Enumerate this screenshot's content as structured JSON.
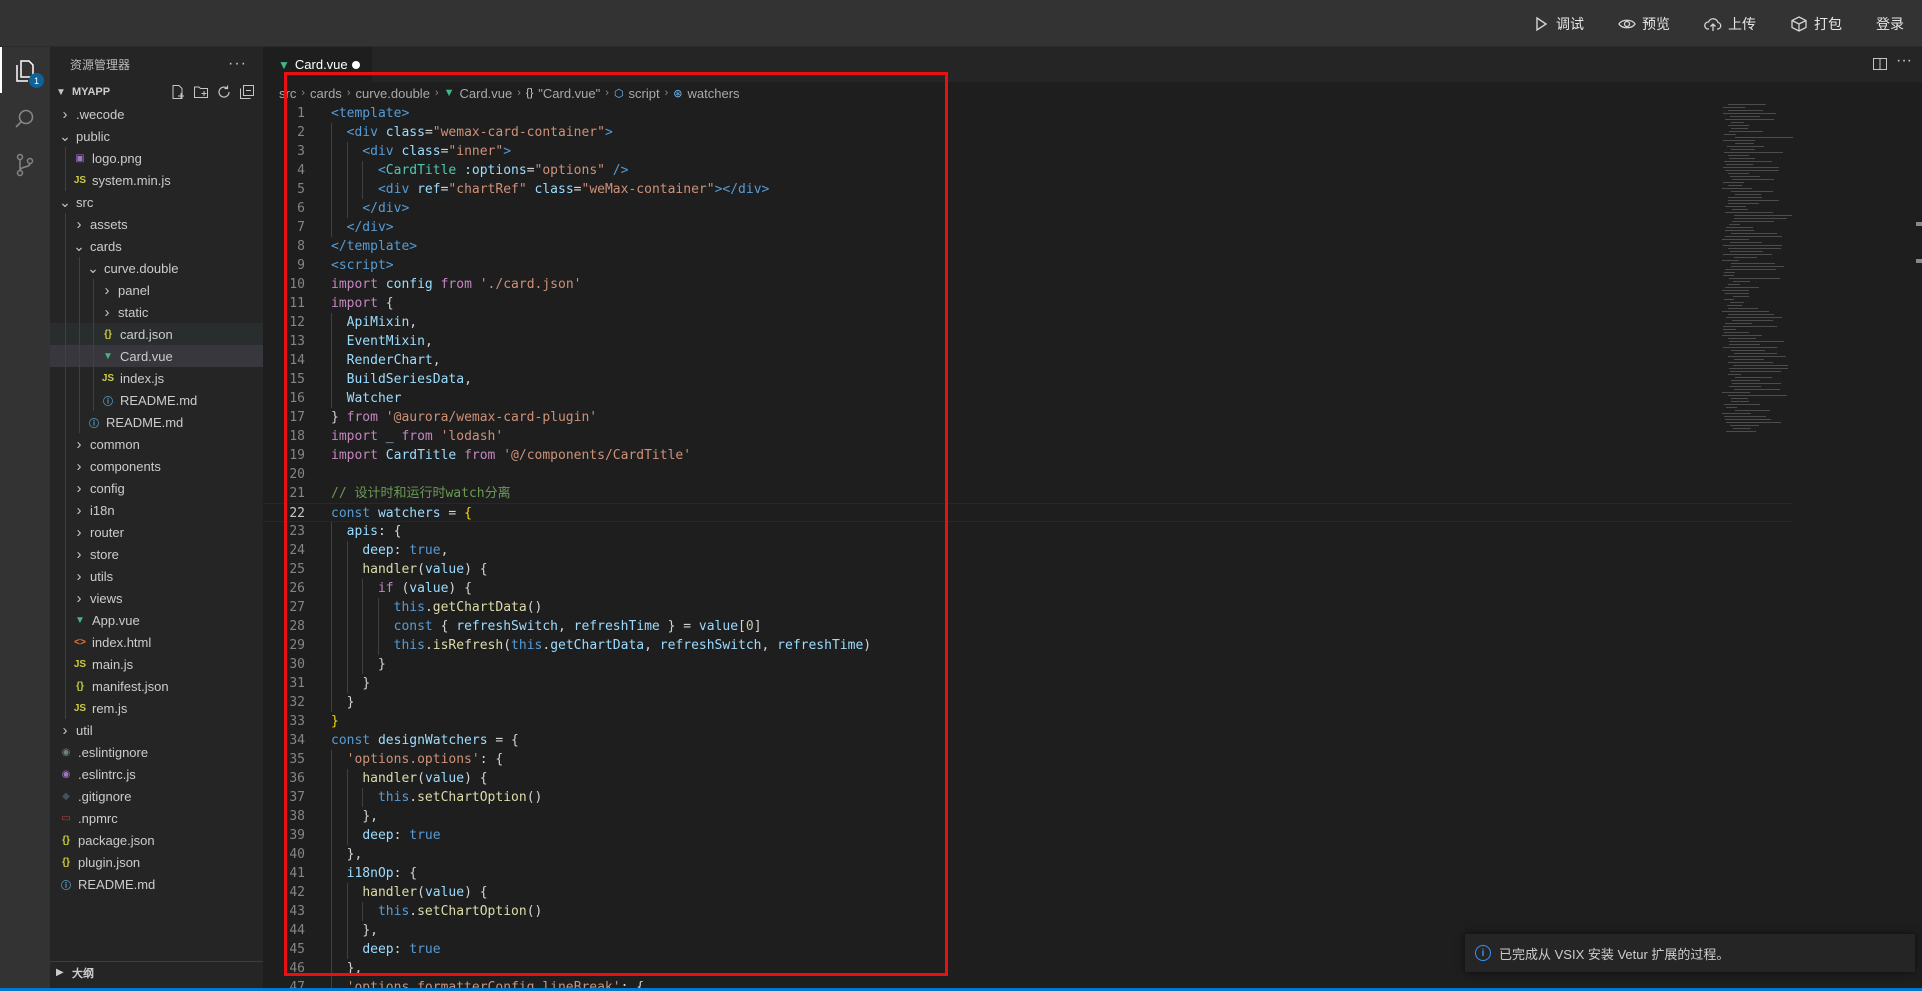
{
  "topbar": {
    "actions": [
      {
        "name": "debug",
        "label": "调试",
        "icon": "play-icon"
      },
      {
        "name": "preview",
        "label": "预览",
        "icon": "eye-icon"
      },
      {
        "name": "upload",
        "label": "上传",
        "icon": "cloud-upload-icon"
      },
      {
        "name": "package",
        "label": "打包",
        "icon": "box-icon"
      },
      {
        "name": "login",
        "label": "登录",
        "icon": ""
      }
    ]
  },
  "activitybar": {
    "explorer_badge": "1"
  },
  "sidebar": {
    "title": "资源管理器",
    "more": "···",
    "section": "MYAPP",
    "outline_label": "大纲",
    "tree": [
      {
        "label": ".wecode",
        "depth": 0,
        "type": "folder",
        "open": false
      },
      {
        "label": "public",
        "depth": 0,
        "type": "folder",
        "open": true
      },
      {
        "label": "logo.png",
        "depth": 1,
        "type": "image"
      },
      {
        "label": "system.min.js",
        "depth": 1,
        "type": "js"
      },
      {
        "label": "src",
        "depth": 0,
        "type": "folder",
        "open": true
      },
      {
        "label": "assets",
        "depth": 1,
        "type": "folder",
        "open": false
      },
      {
        "label": "cards",
        "depth": 1,
        "type": "folder",
        "open": true
      },
      {
        "label": "curve.double",
        "depth": 2,
        "type": "folder",
        "open": true
      },
      {
        "label": "panel",
        "depth": 3,
        "type": "folder",
        "open": false
      },
      {
        "label": "static",
        "depth": 3,
        "type": "folder",
        "open": false
      },
      {
        "label": "card.json",
        "depth": 3,
        "type": "json",
        "state": "hovered"
      },
      {
        "label": "Card.vue",
        "depth": 3,
        "type": "vue",
        "state": "selected"
      },
      {
        "label": "index.js",
        "depth": 3,
        "type": "js"
      },
      {
        "label": "README.md",
        "depth": 3,
        "type": "info"
      },
      {
        "label": "README.md",
        "depth": 2,
        "type": "info"
      },
      {
        "label": "common",
        "depth": 1,
        "type": "folder",
        "open": false
      },
      {
        "label": "components",
        "depth": 1,
        "type": "folder",
        "open": false
      },
      {
        "label": "config",
        "depth": 1,
        "type": "folder",
        "open": false
      },
      {
        "label": "i18n",
        "depth": 1,
        "type": "folder",
        "open": false
      },
      {
        "label": "router",
        "depth": 1,
        "type": "folder",
        "open": false
      },
      {
        "label": "store",
        "depth": 1,
        "type": "folder",
        "open": false
      },
      {
        "label": "utils",
        "depth": 1,
        "type": "folder",
        "open": false
      },
      {
        "label": "views",
        "depth": 1,
        "type": "folder",
        "open": false
      },
      {
        "label": "App.vue",
        "depth": 1,
        "type": "vue"
      },
      {
        "label": "index.html",
        "depth": 1,
        "type": "html"
      },
      {
        "label": "main.js",
        "depth": 1,
        "type": "js"
      },
      {
        "label": "manifest.json",
        "depth": 1,
        "type": "json"
      },
      {
        "label": "rem.js",
        "depth": 1,
        "type": "js"
      },
      {
        "label": "util",
        "depth": 0,
        "type": "folder",
        "open": false
      },
      {
        "label": ".eslintignore",
        "depth": 0,
        "type": "eslintignore"
      },
      {
        "label": ".eslintrc.js",
        "depth": 0,
        "type": "eslint"
      },
      {
        "label": ".gitignore",
        "depth": 0,
        "type": "git"
      },
      {
        "label": ".npmrc",
        "depth": 0,
        "type": "npm"
      },
      {
        "label": "package.json",
        "depth": 0,
        "type": "json"
      },
      {
        "label": "plugin.json",
        "depth": 0,
        "type": "json"
      },
      {
        "label": "README.md",
        "depth": 0,
        "type": "info"
      }
    ]
  },
  "editor": {
    "tab": {
      "label": "Card.vue",
      "modified": true
    },
    "breadcrumb": [
      "src",
      "cards",
      "curve.double",
      "Card.vue",
      "\"Card.vue\"",
      "script",
      "watchers"
    ],
    "breadcrumb_icons": [
      "",
      "",
      "",
      "vue-icon",
      "braces-icon",
      "cube-icon",
      "symbol-icon"
    ],
    "current_line": 22,
    "lines": [
      {
        "n": "1",
        "indent": 0,
        "tokens": [
          [
            "tag",
            "<template>"
          ]
        ]
      },
      {
        "n": "2",
        "indent": 1,
        "tokens": [
          [
            "tag",
            "<div "
          ],
          [
            "attr",
            "class"
          ],
          [
            "plain",
            "="
          ],
          [
            "str",
            "\"wemax-card-container\""
          ],
          [
            "tag",
            ">"
          ]
        ]
      },
      {
        "n": "3",
        "indent": 2,
        "tokens": [
          [
            "tag",
            "<div "
          ],
          [
            "attr",
            "class"
          ],
          [
            "plain",
            "="
          ],
          [
            "str",
            "\"inner\""
          ],
          [
            "tag",
            ">"
          ]
        ]
      },
      {
        "n": "4",
        "indent": 3,
        "tokens": [
          [
            "tag",
            "<"
          ],
          [
            "comp",
            "CardTitle"
          ],
          [
            "attr",
            " :options"
          ],
          [
            "plain",
            "="
          ],
          [
            "str",
            "\"options\""
          ],
          [
            "tag",
            " />"
          ]
        ]
      },
      {
        "n": "5",
        "indent": 3,
        "tokens": [
          [
            "tag",
            "<div "
          ],
          [
            "attr",
            "ref"
          ],
          [
            "plain",
            "="
          ],
          [
            "str",
            "\"chartRef\""
          ],
          [
            "attr",
            " class"
          ],
          [
            "plain",
            "="
          ],
          [
            "str",
            "\"weMax-container\""
          ],
          [
            "tag",
            "></div>"
          ]
        ]
      },
      {
        "n": "6",
        "indent": 2,
        "tokens": [
          [
            "tag",
            "</div>"
          ]
        ]
      },
      {
        "n": "7",
        "indent": 1,
        "tokens": [
          [
            "tag",
            "</div>"
          ]
        ]
      },
      {
        "n": "8",
        "indent": 0,
        "tokens": [
          [
            "tag",
            "</template>"
          ]
        ]
      },
      {
        "n": "9",
        "indent": 0,
        "tokens": [
          [
            "tag",
            "<script>"
          ]
        ]
      },
      {
        "n": "10",
        "indent": 0,
        "tokens": [
          [
            "kw",
            "import "
          ],
          [
            "var",
            "config "
          ],
          [
            "kw",
            "from "
          ],
          [
            "str",
            "'./card.json'"
          ]
        ]
      },
      {
        "n": "11",
        "indent": 0,
        "tokens": [
          [
            "kw",
            "import "
          ],
          [
            "plain",
            "{"
          ]
        ]
      },
      {
        "n": "12",
        "indent": 1,
        "tokens": [
          [
            "var",
            "ApiMixin"
          ],
          [
            "plain",
            ","
          ]
        ]
      },
      {
        "n": "13",
        "indent": 1,
        "tokens": [
          [
            "var",
            "EventMixin"
          ],
          [
            "plain",
            ","
          ]
        ]
      },
      {
        "n": "14",
        "indent": 1,
        "tokens": [
          [
            "var",
            "RenderChart"
          ],
          [
            "plain",
            ","
          ]
        ]
      },
      {
        "n": "15",
        "indent": 1,
        "tokens": [
          [
            "var",
            "BuildSeriesData"
          ],
          [
            "plain",
            ","
          ]
        ]
      },
      {
        "n": "16",
        "indent": 1,
        "tokens": [
          [
            "var",
            "Watcher"
          ]
        ]
      },
      {
        "n": "17",
        "indent": 0,
        "tokens": [
          [
            "plain",
            "} "
          ],
          [
            "kw",
            "from "
          ],
          [
            "str",
            "'@aurora/wemax-card-plugin'"
          ]
        ]
      },
      {
        "n": "18",
        "indent": 0,
        "tokens": [
          [
            "kw",
            "import "
          ],
          [
            "var",
            "_ "
          ],
          [
            "kw",
            "from "
          ],
          [
            "str",
            "'lodash'"
          ]
        ]
      },
      {
        "n": "19",
        "indent": 0,
        "tokens": [
          [
            "kw",
            "import "
          ],
          [
            "var",
            "CardTitle "
          ],
          [
            "kw",
            "from "
          ],
          [
            "str",
            "'@/components/CardTitle'"
          ]
        ]
      },
      {
        "n": "20",
        "indent": 0,
        "tokens": []
      },
      {
        "n": "21",
        "indent": 0,
        "tokens": [
          [
            "cmt",
            "// 设计时和运行时watch分离"
          ]
        ]
      },
      {
        "n": "22",
        "indent": 0,
        "tokens": [
          [
            "decl",
            "const "
          ],
          [
            "var",
            "watchers "
          ],
          [
            "plain",
            "= "
          ],
          [
            "bracket",
            "{"
          ]
        ]
      },
      {
        "n": "23",
        "indent": 1,
        "tokens": [
          [
            "var",
            "apis"
          ],
          [
            "plain",
            ": {"
          ]
        ]
      },
      {
        "n": "24",
        "indent": 2,
        "tokens": [
          [
            "var",
            "deep"
          ],
          [
            "plain",
            ": "
          ],
          [
            "bool",
            "true"
          ],
          [
            "plain",
            ","
          ]
        ]
      },
      {
        "n": "25",
        "indent": 2,
        "tokens": [
          [
            "fn",
            "handler"
          ],
          [
            "plain",
            "("
          ],
          [
            "var",
            "value"
          ],
          [
            "plain",
            ") {"
          ]
        ]
      },
      {
        "n": "26",
        "indent": 3,
        "tokens": [
          [
            "kw",
            "if "
          ],
          [
            "plain",
            "("
          ],
          [
            "var",
            "value"
          ],
          [
            "plain",
            ") {"
          ]
        ]
      },
      {
        "n": "27",
        "indent": 4,
        "tokens": [
          [
            "decl",
            "this"
          ],
          [
            "plain",
            "."
          ],
          [
            "fn",
            "getChartData"
          ],
          [
            "plain",
            "()"
          ]
        ]
      },
      {
        "n": "28",
        "indent": 4,
        "tokens": [
          [
            "decl",
            "const "
          ],
          [
            "plain",
            "{ "
          ],
          [
            "var",
            "refreshSwitch"
          ],
          [
            "plain",
            ", "
          ],
          [
            "var",
            "refreshTime"
          ],
          [
            "plain",
            " } = "
          ],
          [
            "var",
            "value"
          ],
          [
            "plain",
            "["
          ],
          [
            "num",
            "0"
          ],
          [
            "plain",
            "]"
          ]
        ]
      },
      {
        "n": "29",
        "indent": 4,
        "tokens": [
          [
            "decl",
            "this"
          ],
          [
            "plain",
            "."
          ],
          [
            "fn",
            "isRefresh"
          ],
          [
            "plain",
            "("
          ],
          [
            "decl",
            "this"
          ],
          [
            "plain",
            "."
          ],
          [
            "var",
            "getChartData"
          ],
          [
            "plain",
            ", "
          ],
          [
            "var",
            "refreshSwitch"
          ],
          [
            "plain",
            ", "
          ],
          [
            "var",
            "refreshTime"
          ],
          [
            "plain",
            ")"
          ]
        ]
      },
      {
        "n": "30",
        "indent": 3,
        "tokens": [
          [
            "plain",
            "}"
          ]
        ]
      },
      {
        "n": "31",
        "indent": 2,
        "tokens": [
          [
            "plain",
            "}"
          ]
        ]
      },
      {
        "n": "32",
        "indent": 1,
        "tokens": [
          [
            "plain",
            "}"
          ]
        ]
      },
      {
        "n": "33",
        "indent": 0,
        "tokens": [
          [
            "bracket",
            "}"
          ]
        ]
      },
      {
        "n": "34",
        "indent": 0,
        "tokens": [
          [
            "decl",
            "const "
          ],
          [
            "var",
            "designWatchers "
          ],
          [
            "plain",
            "= {"
          ]
        ]
      },
      {
        "n": "35",
        "indent": 1,
        "tokens": [
          [
            "str",
            "'options.options'"
          ],
          [
            "plain",
            ": {"
          ]
        ]
      },
      {
        "n": "36",
        "indent": 2,
        "tokens": [
          [
            "fn",
            "handler"
          ],
          [
            "plain",
            "("
          ],
          [
            "var",
            "value"
          ],
          [
            "plain",
            ") {"
          ]
        ]
      },
      {
        "n": "37",
        "indent": 3,
        "tokens": [
          [
            "decl",
            "this"
          ],
          [
            "plain",
            "."
          ],
          [
            "fn",
            "setChartOption"
          ],
          [
            "plain",
            "()"
          ]
        ]
      },
      {
        "n": "38",
        "indent": 2,
        "tokens": [
          [
            "plain",
            "},"
          ]
        ]
      },
      {
        "n": "39",
        "indent": 2,
        "tokens": [
          [
            "var",
            "deep"
          ],
          [
            "plain",
            ": "
          ],
          [
            "bool",
            "true"
          ]
        ]
      },
      {
        "n": "40",
        "indent": 1,
        "tokens": [
          [
            "plain",
            "},"
          ]
        ]
      },
      {
        "n": "41",
        "indent": 1,
        "tokens": [
          [
            "var",
            "i18nOp"
          ],
          [
            "plain",
            ": {"
          ]
        ]
      },
      {
        "n": "42",
        "indent": 2,
        "tokens": [
          [
            "fn",
            "handler"
          ],
          [
            "plain",
            "("
          ],
          [
            "var",
            "value"
          ],
          [
            "plain",
            ") {"
          ]
        ]
      },
      {
        "n": "43",
        "indent": 3,
        "tokens": [
          [
            "decl",
            "this"
          ],
          [
            "plain",
            "."
          ],
          [
            "fn",
            "setChartOption"
          ],
          [
            "plain",
            "()"
          ]
        ]
      },
      {
        "n": "44",
        "indent": 2,
        "tokens": [
          [
            "plain",
            "},"
          ]
        ]
      },
      {
        "n": "45",
        "indent": 2,
        "tokens": [
          [
            "var",
            "deep"
          ],
          [
            "plain",
            ": "
          ],
          [
            "bool",
            "true"
          ]
        ]
      },
      {
        "n": "46",
        "indent": 1,
        "tokens": [
          [
            "plain",
            "},"
          ]
        ]
      },
      {
        "n": "47",
        "indent": 1,
        "tokens": [
          [
            "str",
            "'options.formatterConfig.lineBreak'"
          ],
          [
            "plain",
            ": {"
          ]
        ]
      }
    ]
  },
  "notification": {
    "message": "已完成从 VSIX 安装 Vetur 扩展的过程。"
  }
}
